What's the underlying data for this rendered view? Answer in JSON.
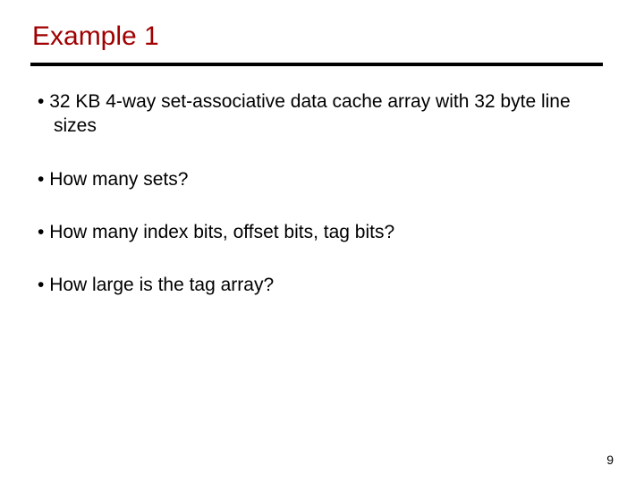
{
  "slide": {
    "title": "Example 1",
    "bullets": [
      "32 KB 4-way set-associative data cache array with 32 byte line sizes",
      "How many sets?",
      "How many index bits, offset bits, tag bits?",
      "How large is the tag array?"
    ],
    "page_number": "9"
  }
}
